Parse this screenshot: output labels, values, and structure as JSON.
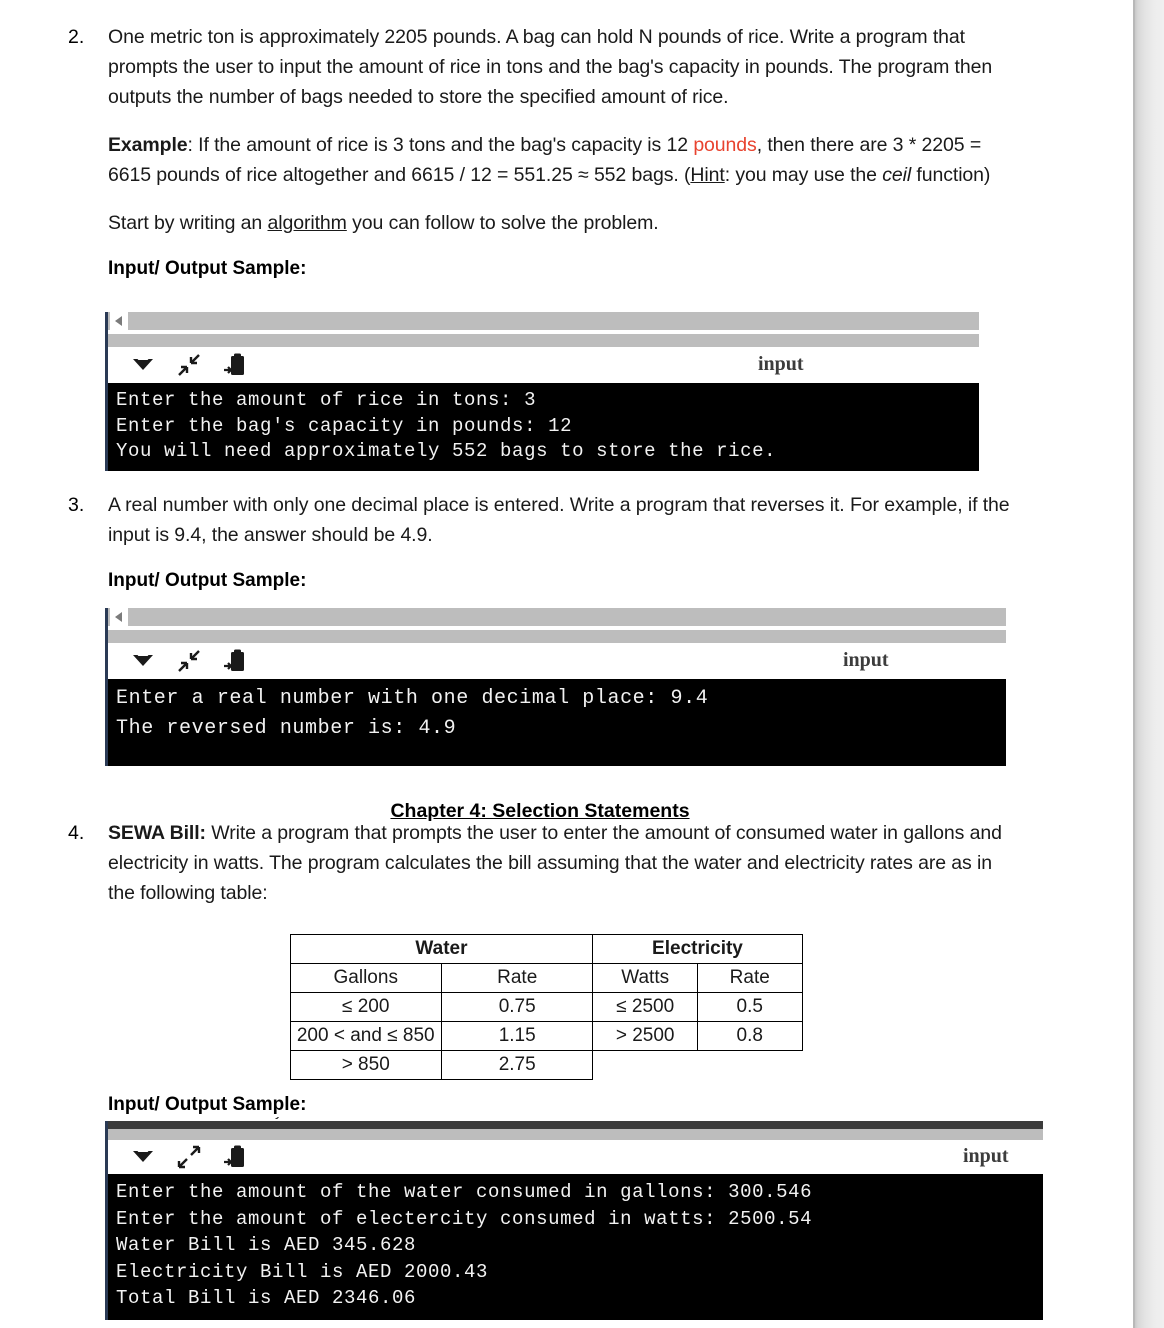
{
  "document": {
    "items": [
      {
        "number": "2.",
        "paragraphs": [
          "One metric ton is approximately 2205 pounds. A bag can hold N pounds of rice. Write a program that prompts the user to input the amount of rice in tons and the bag's capacity in pounds. The program then outputs the number of bags needed to store the specified amount of rice.",
          "Start by writing an algorithm you can follow to solve the problem."
        ],
        "example": {
          "label": "Example",
          "text_1": ": If the amount of rice is 3 tons and the bag's capacity is 12 ",
          "highlight": "pounds",
          "text_2": ", then there are 3 * 2205 = 6615 pounds of rice altogether and 6615 / 12 = 551.25 ≈ 552 bags. (",
          "hint": "Hint",
          "text_3": ": you may use the ",
          "ceil": "ceil",
          "text_4": " function)"
        },
        "start_line": {
          "before": "Start by writing an ",
          "underlined": "algorithm",
          "after": " you can follow to solve the problem."
        },
        "io_label": "Input/ Output Sample:",
        "console": {
          "input_label": "input",
          "icons": [
            "chevron-down-icon",
            "collapse-icon",
            "paste-icon"
          ],
          "lines": [
            "Enter the amount of rice in tons: 3",
            "Enter the bag's capacity in pounds: 12",
            "You will need approximately 552 bags to store the rice."
          ]
        }
      },
      {
        "number": "3.",
        "paragraph": "A real number with only one decimal place is entered. Write a program that reverses it. For example, if the input is 9.4, the answer should be 4.9.",
        "io_label": "Input/ Output Sample:",
        "console": {
          "input_label": "input",
          "ghost_text": "—— ———— — — —— —— ——— ————— —— ———— ———— ——— ———",
          "icons": [
            "chevron-down-icon",
            "collapse-icon",
            "paste-icon"
          ],
          "lines": [
            "Enter a real number with one decimal place: 9.4",
            "The reversed number is: 4.9"
          ]
        }
      }
    ],
    "chapter_heading": "Chapter 4: Selection Statements",
    "item4": {
      "number": "4.",
      "bold_lead": "SEWA Bill:",
      "paragraph": " Write a program that prompts the user to enter the amount of consumed water in gallons and electricity in watts. The program calculates the bill assuming that the water and electricity rates are as in the following table:",
      "io_label": "Input/ Output Sample:",
      "console": {
        "input_label": "input",
        "icons": [
          "chevron-down-icon",
          "expand-icon",
          "paste-icon"
        ],
        "lines": [
          "Enter the amount of the water consumed in gallons: 300.546",
          "Enter the amount of electercity consumed in watts: 2500.54",
          "Water Bill is AED 345.628",
          "Electricity Bill is AED 2000.43",
          "Total Bill is AED 2346.06"
        ]
      }
    },
    "rates_table": {
      "group_headers": [
        "Water",
        "Electricity"
      ],
      "column_headers": [
        "Gallons",
        "Rate",
        "Watts",
        "Rate"
      ],
      "rows": [
        [
          "≤ 200",
          "0.75",
          "≤ 2500",
          "0.5"
        ],
        [
          "200 < and ≤ 850",
          "1.15",
          "> 2500",
          "0.8"
        ],
        [
          "> 850",
          "2.75",
          "",
          ""
        ]
      ]
    }
  },
  "colors": {
    "highlight_red": "#e8432f",
    "terminal_bg": "#000000",
    "terminal_fg": "#f2f2f2",
    "scrollbar": "#bdbdbd",
    "console_border": "#2a3a55"
  }
}
